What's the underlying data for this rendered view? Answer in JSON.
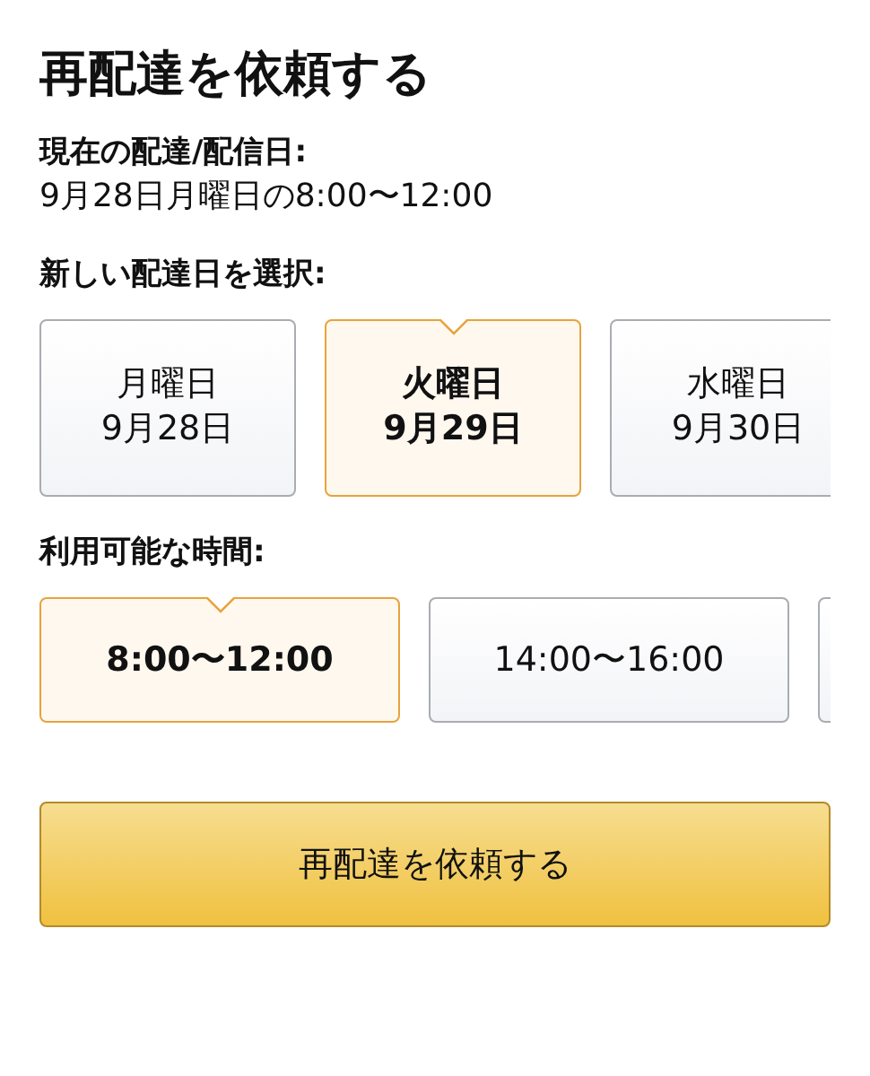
{
  "title": "再配達を依頼する",
  "current": {
    "label": "現在の配達/配信日:",
    "value": "9月28日月曜日の8:00〜12:00"
  },
  "date_section": {
    "label": "新しい配達日を選択:",
    "dates": [
      {
        "weekday": "月曜日",
        "date": "9月28日",
        "selected": false
      },
      {
        "weekday": "火曜日",
        "date": "9月29日",
        "selected": true
      },
      {
        "weekday": "水曜日",
        "date": "9月30日",
        "selected": false
      }
    ]
  },
  "time_section": {
    "label": "利用可能な時間:",
    "slots": [
      {
        "time": "8:00〜12:00",
        "selected": true
      },
      {
        "time": "14:00〜16:00",
        "selected": false
      }
    ]
  },
  "submit_button": "再配達を依頼する"
}
